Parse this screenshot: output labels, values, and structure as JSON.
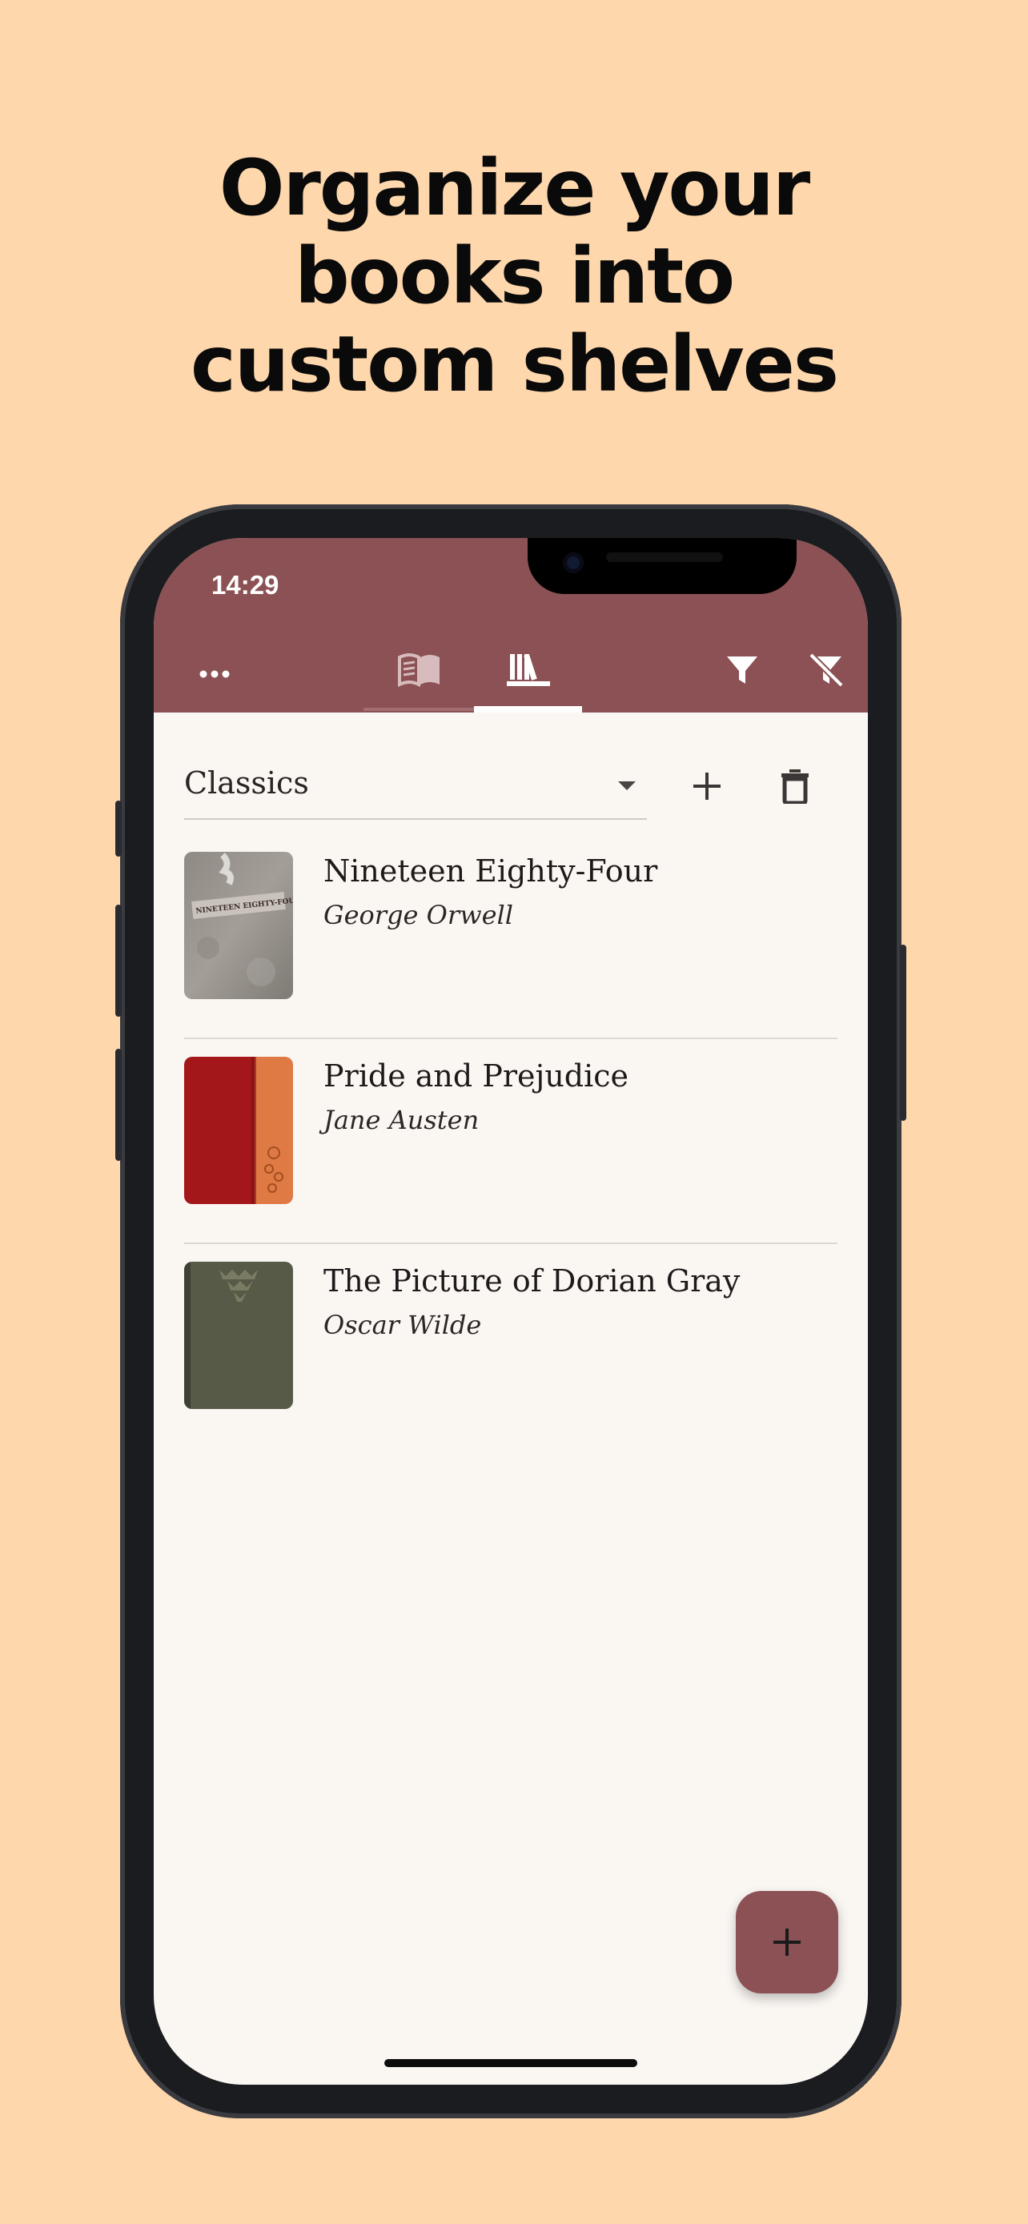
{
  "headline": {
    "line1": "Organize your",
    "line2": "books into",
    "line3": "custom shelves"
  },
  "status_bar": {
    "time": "14:29"
  },
  "toolbar": {
    "icons": [
      "more-icon",
      "open-book-icon",
      "bookshelf-icon",
      "filter-icon",
      "filter-off-icon"
    ],
    "active_tab": "bookshelf"
  },
  "shelf": {
    "selected": "Classics"
  },
  "books": [
    {
      "title": "Nineteen Eighty-Four",
      "author": "George Orwell",
      "cover_label": "NINETEEN EIGHTY-FOUR"
    },
    {
      "title": "Pride and Prejudice",
      "author": "Jane Austen"
    },
    {
      "title": "The Picture of Dorian Gray",
      "author": "Oscar Wilde"
    }
  ],
  "colors": {
    "background": "#FED7AC",
    "appbar": "#8B5154",
    "screen": "#FAF7F3",
    "fab": "#8B5154"
  }
}
